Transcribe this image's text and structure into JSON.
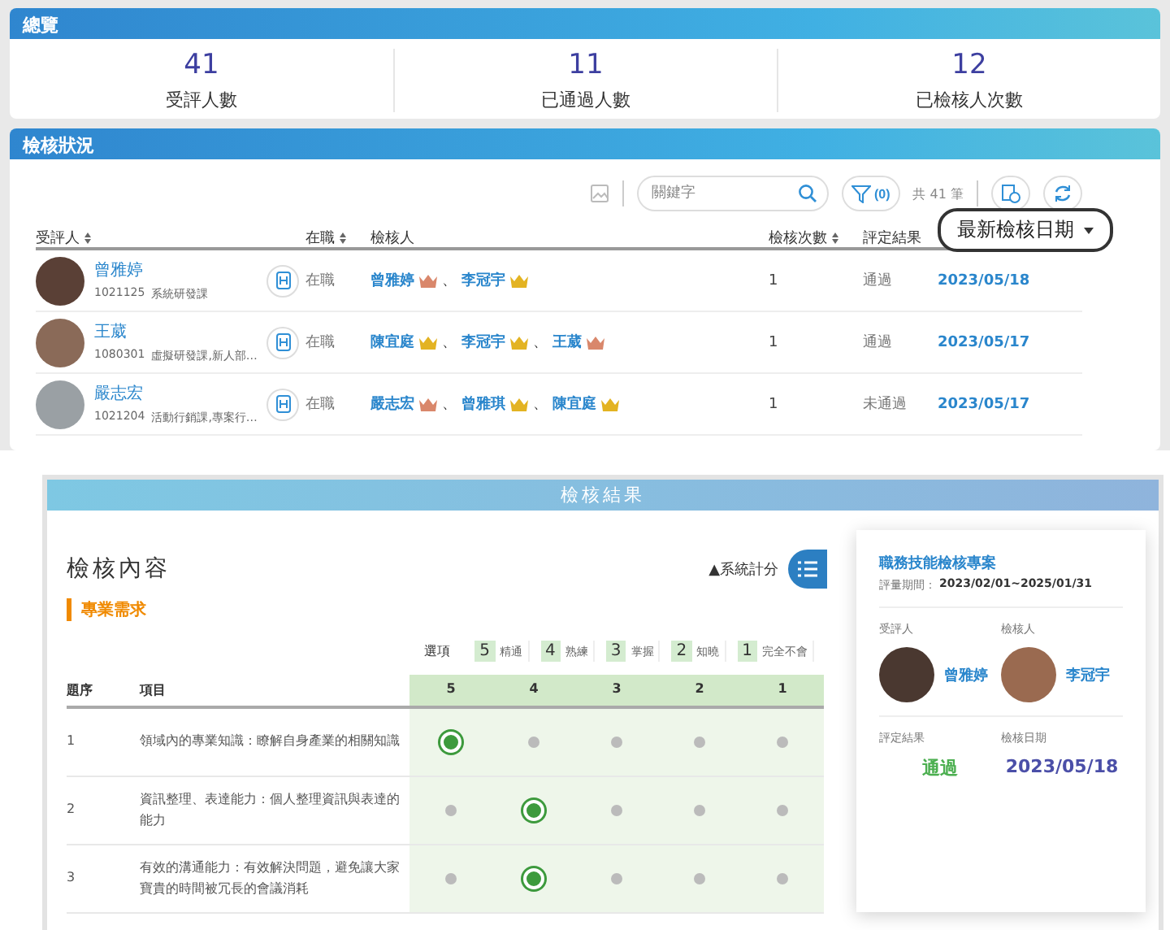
{
  "overview": {
    "title": "總覽",
    "stats": [
      {
        "value": "41",
        "label": "受評人數"
      },
      {
        "value": "11",
        "label": "已通過人數"
      },
      {
        "value": "12",
        "label": "已檢核人次數"
      }
    ]
  },
  "status": {
    "title": "檢核狀況",
    "search": {
      "placeholder": "關鍵字"
    },
    "filter": "(0)",
    "total": "共 41 筆",
    "columns": [
      {
        "label": "受評人",
        "sortable": true,
        "highlighted": false
      },
      {
        "label": "在職",
        "sortable": true,
        "highlighted": false
      },
      {
        "label": "檢核人",
        "sortable": false,
        "highlighted": false
      },
      {
        "label": "檢核次數",
        "sortable": true,
        "highlighted": false
      },
      {
        "label": "評定結果",
        "sortable": false,
        "highlighted": false
      },
      {
        "label": "最新檢核日期",
        "sortable": true,
        "highlighted": true
      }
    ],
    "rows": [
      {
        "name": "曾雅婷",
        "id": "1021125",
        "dept": "系統研發課",
        "employment": "在職",
        "reviewers": [
          {
            "name": "曾雅婷",
            "color": "#d9876b"
          },
          {
            "separator": "、",
            "name": "李冠宇",
            "color": "#e3b322"
          }
        ],
        "count": "1",
        "result": "通過",
        "date": "2023/05/18"
      },
      {
        "name": "王葳",
        "id": "1080301",
        "dept": "虛擬研發課,新人部…",
        "employment": "在職",
        "reviewers": [
          {
            "name": "陳宜庭",
            "color": "#e3b322"
          },
          {
            "separator": "、",
            "name": "李冠宇",
            "color": "#e3b322"
          },
          {
            "separator": "、",
            "name": "王葳",
            "color": "#d9876b"
          }
        ],
        "count": "1",
        "result": "通過",
        "date": "2023/05/17"
      },
      {
        "name": "嚴志宏",
        "id": "1021204",
        "dept": "活動行銷課,專案行…",
        "employment": "在職",
        "reviewers": [
          {
            "name": "嚴志宏",
            "color": "#d9876b"
          },
          {
            "separator": "、",
            "name": "曾雅琪",
            "color": "#e3b322"
          },
          {
            "separator": "、",
            "name": "陳宜庭",
            "color": "#e3b322"
          }
        ],
        "count": "1",
        "result": "未通過",
        "date": "2023/05/17"
      }
    ]
  },
  "result": {
    "title": "檢核結果",
    "section_title": "檢核內容",
    "category": "專業需求",
    "score_toggle": "▲系統計分",
    "legend_label": "選項",
    "legend": [
      {
        "score": "5",
        "label": "精通"
      },
      {
        "score": "4",
        "label": "熟練"
      },
      {
        "score": "3",
        "label": "掌握"
      },
      {
        "score": "2",
        "label": "知曉"
      },
      {
        "score": "1",
        "label": "完全不會"
      }
    ],
    "columns": {
      "order": "題序",
      "item": "項目",
      "scores": [
        "5",
        "4",
        "3",
        "2",
        "1"
      ]
    },
    "items": [
      {
        "order": "1",
        "text": "領域內的專業知識：瞭解自身產業的相關知識",
        "ratings": [
          {
            "selected": true
          },
          {
            "selected": false
          },
          {
            "selected": false
          },
          {
            "selected": false
          },
          {
            "selected": false
          }
        ]
      },
      {
        "order": "2",
        "text": "資訊整理、表達能力：個人整理資訊與表達的能力",
        "ratings": [
          {
            "selected": false
          },
          {
            "selected": true
          },
          {
            "selected": false
          },
          {
            "selected": false
          },
          {
            "selected": false
          }
        ]
      },
      {
        "order": "3",
        "text": "有效的溝通能力：有效解決問題，避免讓大家寶貴的時間被冗長的會議消耗",
        "ratings": [
          {
            "selected": false
          },
          {
            "selected": true
          },
          {
            "selected": false
          },
          {
            "selected": false
          },
          {
            "selected": false
          }
        ]
      }
    ],
    "card": {
      "project": "職務技能檢核專案",
      "period_label": "評量期間：",
      "period": "2023/02/01~2025/01/31",
      "reviewee_label": "受評人",
      "reviewee": "曾雅婷",
      "reviewer_label": "檢核人",
      "reviewer": "李冠宇",
      "result_label": "評定結果",
      "result": "通過",
      "date_label": "檢核日期",
      "date": "2023/05/18"
    }
  }
}
